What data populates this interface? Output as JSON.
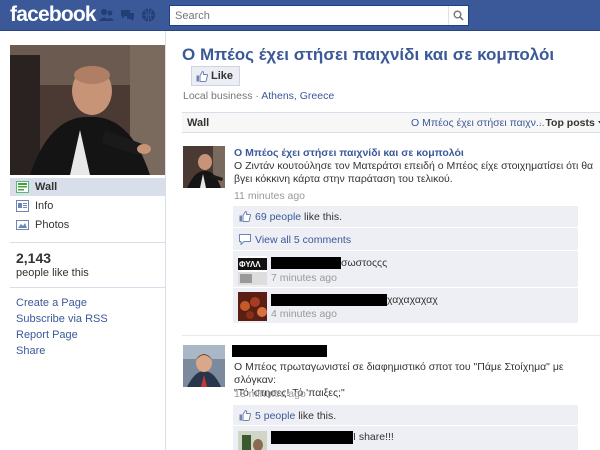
{
  "topbar": {
    "logo": "facebook",
    "search_placeholder": "Search",
    "icons": [
      "friend-requests-icon",
      "messages-icon",
      "notifications-icon"
    ]
  },
  "sidebar": {
    "nav": [
      {
        "label": "Wall",
        "icon": "wall-icon"
      },
      {
        "label": "Info",
        "icon": "info-icon"
      },
      {
        "label": "Photos",
        "icon": "photos-icon"
      }
    ],
    "likes_count": "2,143",
    "likes_label": "people like this",
    "links": [
      "Create a Page",
      "Subscribe via RSS",
      "Report Page",
      "Share"
    ]
  },
  "page": {
    "title": "Ο Μπέος έχει στήσει παιχνίδι και σε κομπολόι",
    "like_label": "Like",
    "category": "Local business",
    "separator": " · ",
    "location": "Athens, Greece"
  },
  "wall": {
    "label": "Wall",
    "filter": "Ο Μπέος έχει στήσει παιχν...",
    "sort_sep": " · ",
    "sort": "Top posts"
  },
  "posts": [
    {
      "author": "Ο Μπέος έχει στήσει παιχνίδι και σε κομπολόι",
      "text_line1": "Ο Ζιντάν κουτούλησε τον Ματεράτσι επειδή ο Μπέος είχε στοιχηματίσει ότι θα",
      "text_line2": "βγει κόκκινη κάρτα στην παράταση του τελικού.",
      "time": "11 minutes ago",
      "likes_link": "69 people",
      "likes_rest": " like this.",
      "view_comments": "View all 5 comments",
      "comments": [
        {
          "text": "σωστοςςς",
          "time": "7 minutes ago"
        },
        {
          "text": "χαχαχαχαχ",
          "time": "4 minutes ago"
        }
      ]
    },
    {
      "text_line1": "Ο Μπέος πρωταγωνιστεί σε διαφημιστικό σποτ του \"Πάμε Στοίχημα\" με σλόγκαν:",
      "text_line2": "\"Τό 'στησες! Τό 'παιξες;\"",
      "time": "13 minutes ago",
      "likes_link": "5 people",
      "likes_rest": " like this.",
      "comments": [
        {
          "text": "I share!!!"
        }
      ]
    }
  ],
  "colors": {
    "brand": "#3b5998",
    "sidebar_selected": "#d8dfea",
    "ufi_box": "#edeff4"
  }
}
